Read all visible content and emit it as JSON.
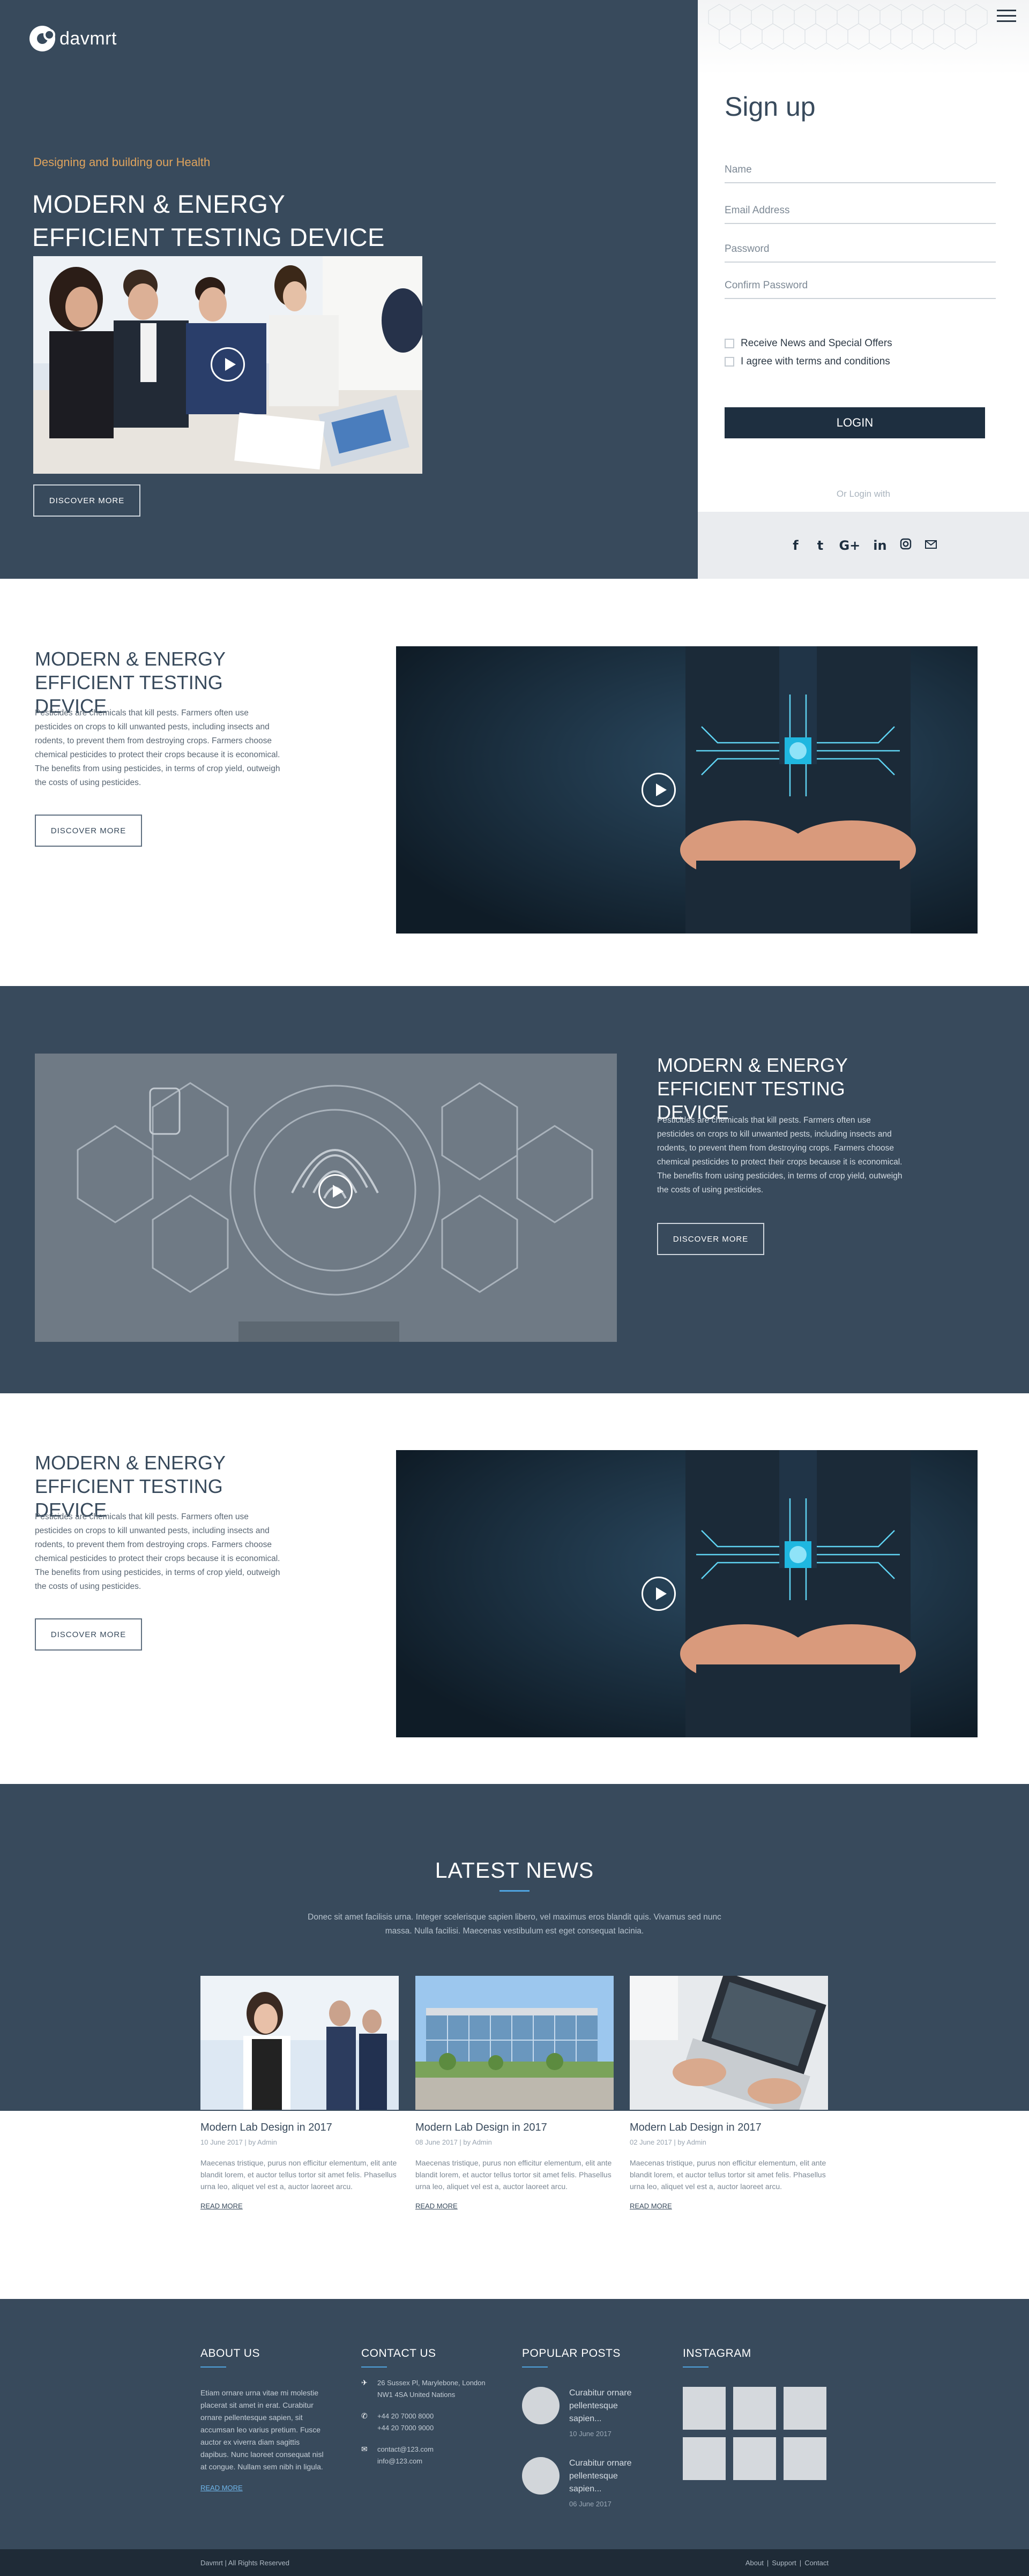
{
  "header": {
    "logo_text": "davmrt",
    "tagline": "Designing and building our Health",
    "title": "MODERN & ENERGY EFFICIENT TESTING DEVICE",
    "cta": "DISCOVER MORE"
  },
  "signup": {
    "title": "Sign up",
    "fields": {
      "name": "Name",
      "email": "Email Address",
      "password": "Password",
      "confirm": "Confirm Password"
    },
    "checkbox_news": "Receive News and Special Offers",
    "checkbox_terms": "I agree with terms and conditions",
    "login_label": "LOGIN",
    "or_login": "Or Login with",
    "social": [
      "f",
      "t",
      "G+",
      "in",
      "ig",
      "mail"
    ]
  },
  "features": [
    {
      "title": "MODERN & ENERGY EFFICIENT TESTING DEVICE",
      "body": "Pesticides are chemicals that kill pests. Farmers often use pesticides on crops to kill unwanted pests, including insects and rodents, to prevent them from destroying crops. Farmers choose chemical pesticides to protect their crops because it is economical. The benefits from using pesticides, in terms of crop yield, outweigh the costs of using pesticides.",
      "cta": "DISCOVER MORE"
    },
    {
      "title": "MODERN & ENERGY EFFICIENT TESTING DEVICE",
      "body": "Pesticides are chemicals that kill pests. Farmers often use pesticides on crops to kill unwanted pests, including insects and rodents, to prevent them from destroying crops. Farmers choose chemical pesticides to protect their crops because it is economical. The benefits from using pesticides, in terms of crop yield, outweigh the costs of using pesticides.",
      "cta": "DISCOVER MORE"
    },
    {
      "title": "MODERN & ENERGY EFFICIENT TESTING DEVICE",
      "body": "Pesticides are chemicals that kill pests. Farmers often use pesticides on crops to kill unwanted pests, including insects and rodents, to prevent them from destroying crops. Farmers choose chemical pesticides to protect their crops because it is economical. The benefits from using pesticides, in terms of crop yield, outweigh the costs of using pesticides.",
      "cta": "DISCOVER MORE"
    }
  ],
  "news": {
    "title": "LATEST NEWS",
    "subtitle": "Donec sit amet facilisis urna. Integer scelerisque sapien libero, vel maximus eros blandit quis. Vivamus sed nunc massa. Nulla facilisi. Maecenas vestibulum est eget consequat lacinia.",
    "items": [
      {
        "title": "Modern Lab Design in 2017",
        "meta": "10 June 2017 | by Admin",
        "body": "Maecenas tristique, purus non efficitur elementum, elit ante blandit lorem, et auctor tellus tortor sit amet felis. Phasellus urna leo, aliquet vel est a, auctor laoreet arcu.",
        "link": "READ MORE"
      },
      {
        "title": "Modern Lab Design in 2017",
        "meta": "08 June 2017 | by Admin",
        "body": "Maecenas tristique, purus non efficitur elementum, elit ante blandit lorem, et auctor tellus tortor sit amet felis. Phasellus urna leo, aliquet vel est a, auctor laoreet arcu.",
        "link": "READ MORE"
      },
      {
        "title": "Modern Lab Design in 2017",
        "meta": "02 June 2017 | by Admin",
        "body": "Maecenas tristique, purus non efficitur elementum, elit ante blandit lorem, et auctor tellus tortor sit amet felis. Phasellus urna leo, aliquet vel est a, auctor laoreet arcu.",
        "link": "READ MORE"
      }
    ]
  },
  "footer": {
    "about": {
      "title": "ABOUT US",
      "text": "Etiam ornare urna vitae mi molestie placerat sit amet in erat. Curabitur ornare pellentesque sapien, sit accumsan leo varius pretium. Fusce auctor ex viverra diam sagittis dapibus. Nunc laoreet consequat nisl at congue. Nullam sem nibh in ligula.",
      "link": "READ MORE"
    },
    "contact": {
      "title": "CONTACT US",
      "address": "26 Sussex Pl, Marylebone, London NW1 4SA United Nations",
      "phone1": "+44 20 7000 8000",
      "phone2": "+44 20 7000 9000",
      "email1": "contact@123.com",
      "email2": "info@123.com"
    },
    "posts": {
      "title": "POPULAR POSTS",
      "items": [
        {
          "title": "Curabitur ornare pellentesque sapien...",
          "date": "10 June 2017"
        },
        {
          "title": "Curabitur ornare pellentesque sapien...",
          "date": "06 June 2017"
        }
      ]
    },
    "instagram": {
      "title": "INSTAGRAM"
    },
    "copyright": "Davmrt | All Rights Reserved",
    "links": [
      "About",
      "Support",
      "Contact"
    ]
  },
  "colors": {
    "primary_dark": "#384a5c",
    "accent_orange": "#e0a45d",
    "accent_blue": "#4fa3df",
    "button_dark": "#1e2f40"
  },
  "icons": [
    "menu-icon",
    "play-icon",
    "facebook-icon",
    "twitter-icon",
    "google-plus-icon",
    "linkedin-icon",
    "instagram-icon",
    "mail-icon",
    "location-icon",
    "phone-icon",
    "email-icon"
  ]
}
